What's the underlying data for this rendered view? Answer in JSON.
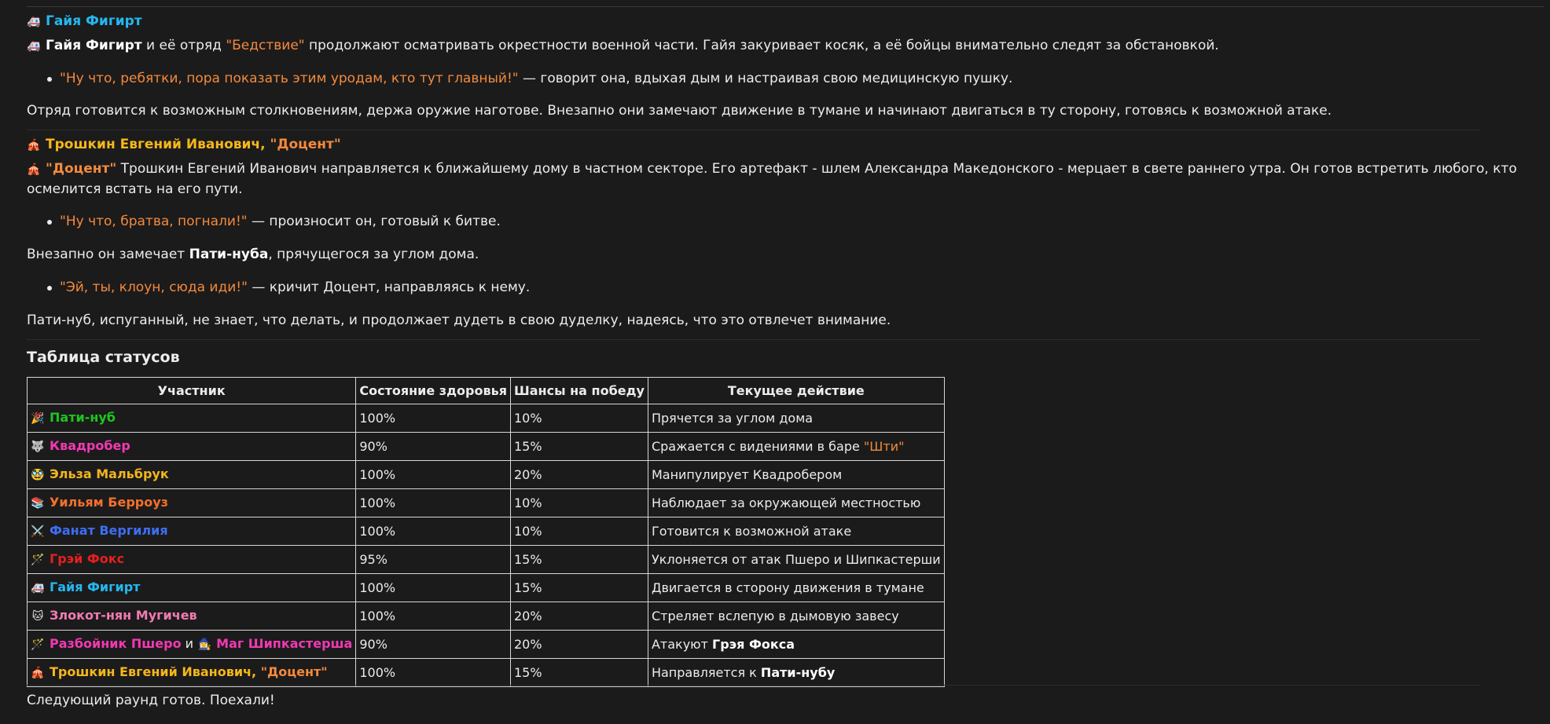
{
  "block1": {
    "header_icon": "🚑",
    "header_name": "Гайя Фигирт",
    "p_icon": "🚑",
    "p_name": "Гайя Фигирт",
    "p_text1": " и её отряд ",
    "p_squad": "\"Бедствие\"",
    "p_text2": " продолжают осматривать окрестности военной части. Гайя закуривает косяк, а её бойцы внимательно следят за обстановкой.",
    "quote": "\"Ну что, ребятки, пора показать этим уродам, кто тут главный!\"",
    "quote_tail": " — говорит она, вдыхая дым и настраивая свою медицинскую пушку.",
    "para": "Отряд готовится к возможным столкновениям, держа оружие наготове. Внезапно они замечают движение в тумане и начинают двигаться в ту сторону, готовясь к возможной атаке."
  },
  "block2": {
    "header_icon": "🎪",
    "header_name": "Трошкин Евгений Иванович, ",
    "header_nick": "\"Доцент\"",
    "p_icon": "🎪",
    "p_nick": "\"Доцент\"",
    "p_text": " Трошкин Евгений Иванович направляется к ближайшему дому в частном секторе. Его артефакт - шлем Александра Македонского - мерцает в свете раннего утра. Он готов встретить любого, кто осмелится встать на его пути.",
    "quote1": "\"Ну что, братва, погнали!\"",
    "quote1_tail": " — произносит он, готовый к битве.",
    "para1_a": "Внезапно он замечает ",
    "para1_b": "Пати-нуба",
    "para1_c": ", прячущегося за углом дома.",
    "quote2": "\"Эй, ты, клоун, сюда иди!\"",
    "quote2_tail": " — кричит Доцент, направляясь к нему.",
    "para2": "Пати-нуб, испуганный, не знает, что делать, и продолжает дудеть в свою дуделку, надеясь, что это отвлечет внимание."
  },
  "table": {
    "title": "Таблица статусов",
    "headers": [
      "Участник",
      "Состояние здоровья",
      "Шансы на победу",
      "Текущее действие"
    ],
    "rows": [
      {
        "icon": "🎉",
        "name": "Пати-нуб",
        "health": "100%",
        "chance": "10%",
        "action": "Прячется за углом дома"
      },
      {
        "icon": "🐺",
        "name": "Квадробер",
        "health": "90%",
        "chance": "15%",
        "action": "Сражается с видениями в баре ",
        "action_hl": "\"Шти\""
      },
      {
        "icon": "🥸",
        "name": "Эльза Мальбрук",
        "health": "100%",
        "chance": "20%",
        "action": "Манипулирует Квадробером"
      },
      {
        "icon": "📚",
        "name": "Уильям Берроуз",
        "health": "100%",
        "chance": "10%",
        "action": "Наблюдает за окружающей местностью"
      },
      {
        "icon": "⚔️",
        "name": "Фанат Вергилия",
        "health": "100%",
        "chance": "10%",
        "action": "Готовится к возможной атаке"
      },
      {
        "icon": "🪄",
        "name": "Грэй Фокс",
        "health": "95%",
        "chance": "15%",
        "action": "Уклоняется от атак Пшеро и Шипкастерши"
      },
      {
        "icon": "🚑",
        "name": "Гайя Фигирт",
        "health": "100%",
        "chance": "15%",
        "action": "Двигается в сторону движения в тумане"
      },
      {
        "icon": "🐱",
        "name": "Злокот-нян Мугичев",
        "health": "100%",
        "chance": "20%",
        "action": "Стреляет вслепую в дымовую завесу"
      },
      {
        "icon": "🪄",
        "name": "Разбойник Пшеро",
        "name_join": " и ",
        "icon2": "🧙‍♀️",
        "name2": "Маг Шипкастерша",
        "health": "90%",
        "chance": "20%",
        "action": "Атакуют ",
        "action_bold": "Грэя Фокса"
      },
      {
        "icon": "🎪",
        "name": "Трошкин Евгений Иванович, ",
        "name_nick": "\"Доцент\"",
        "health": "100%",
        "chance": "15%",
        "action": "Направляется к ",
        "action_bold": "Пати-нубу"
      }
    ]
  },
  "footer": "Следующий раунд готов. Поехали!"
}
